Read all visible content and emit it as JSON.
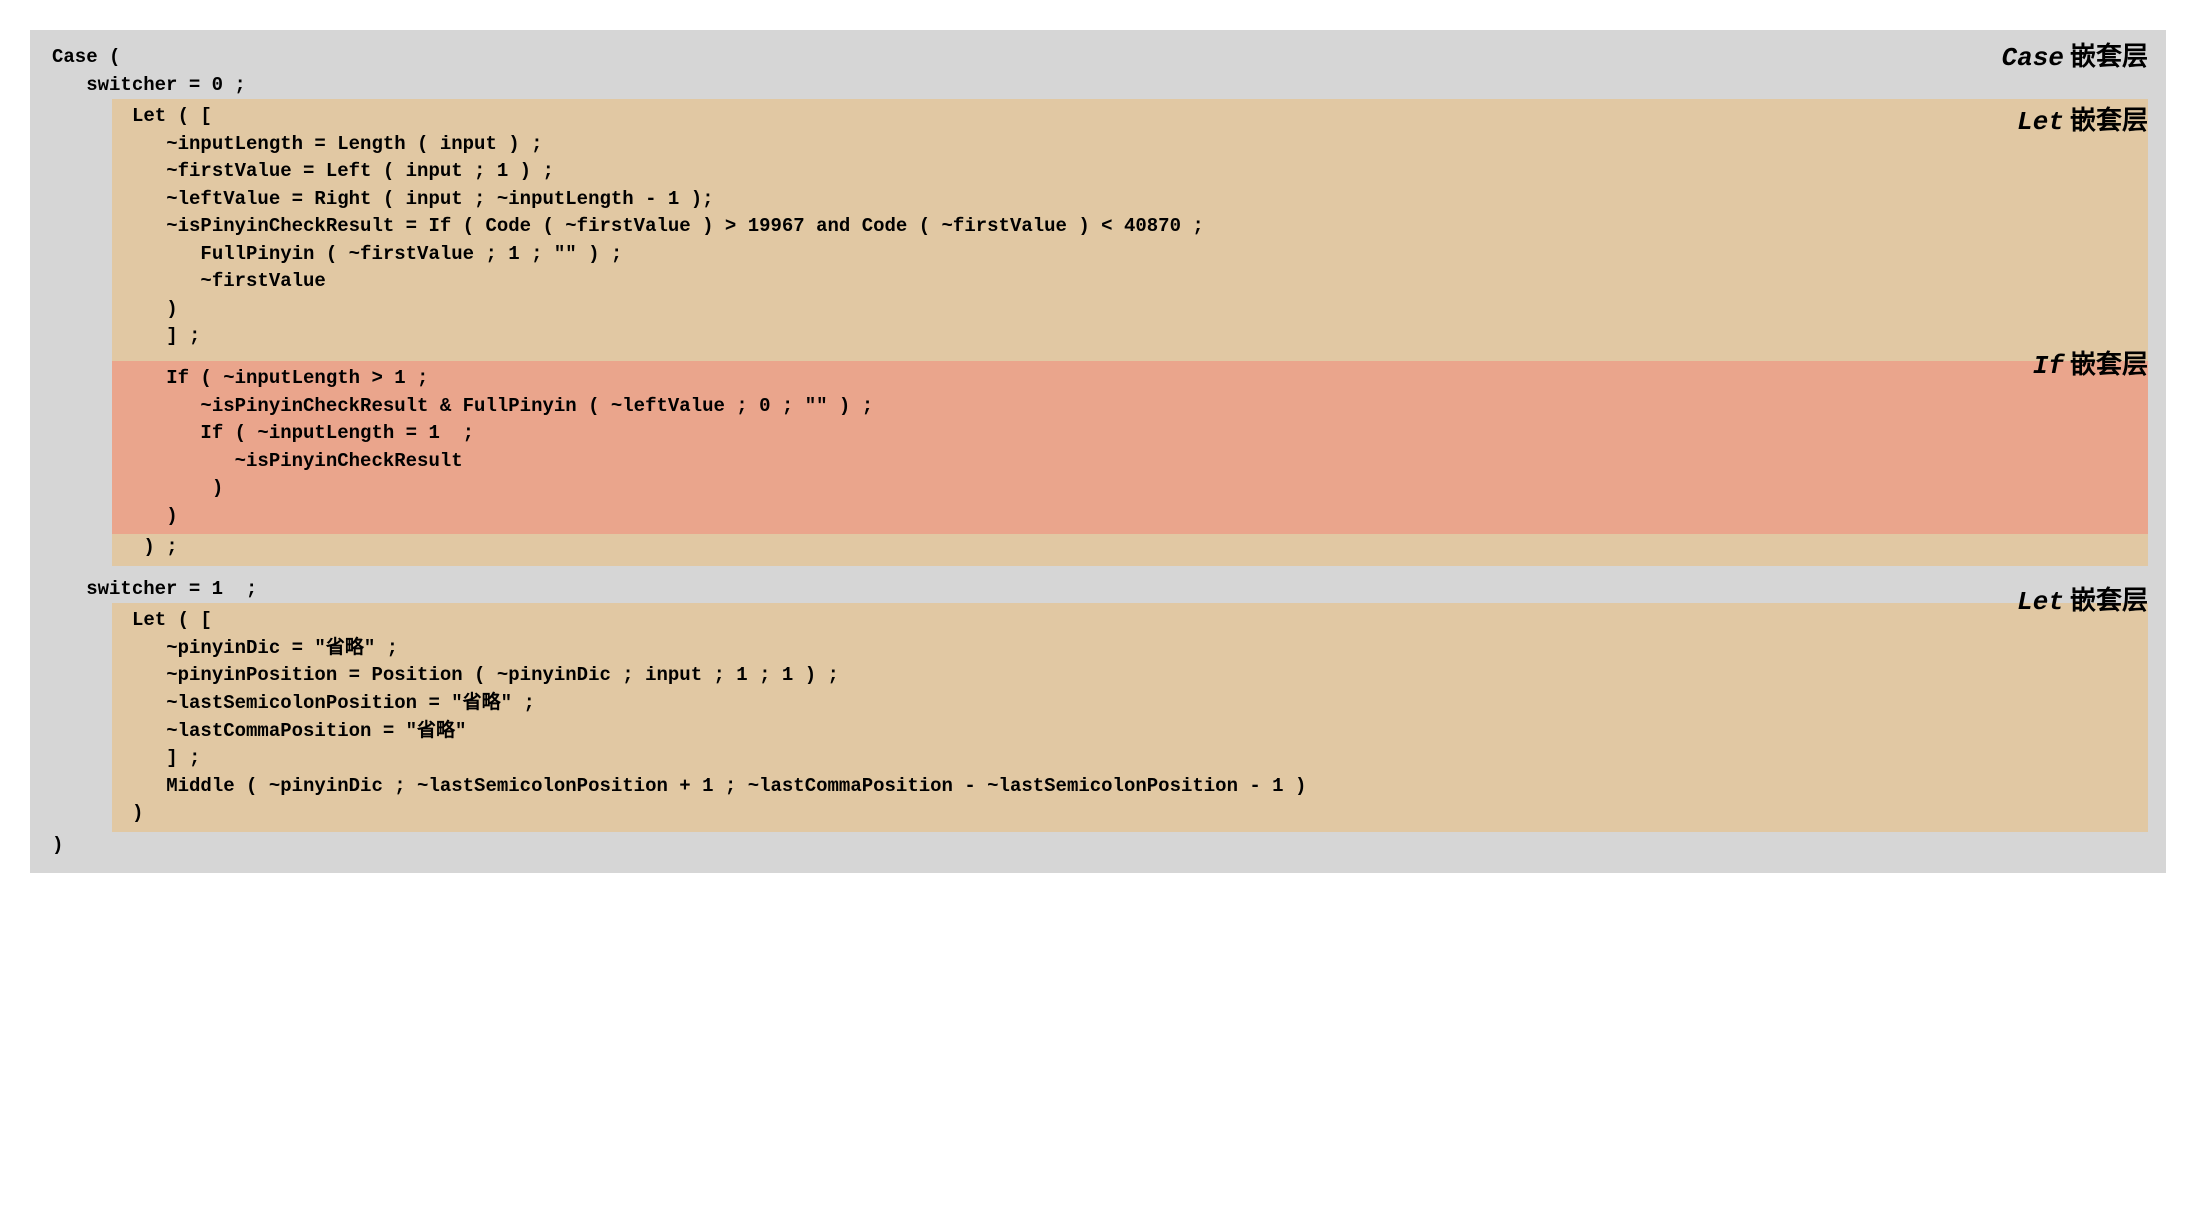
{
  "labels": {
    "case": {
      "kw": "Case",
      "cn": "嵌套层"
    },
    "let1": {
      "kw": "Let",
      "cn": "嵌套层"
    },
    "if": {
      "kw": "If",
      "cn": "嵌套层"
    },
    "let2": {
      "kw": "Let",
      "cn": "嵌套层"
    }
  },
  "code": {
    "case_open": "Case (",
    "switcher0": "   switcher = 0 ;",
    "let1_1": "Let ( [",
    "let1_2": "   ~inputLength = Length ( input ) ;",
    "let1_3": "   ~firstValue = Left ( input ; 1 ) ;",
    "let1_4": "   ~leftValue = Right ( input ; ~inputLength - 1 );",
    "let1_5": "   ~isPinyinCheckResult = If ( Code ( ~firstValue ) > 19967 and Code ( ~firstValue ) < 40870 ;",
    "let1_6": "      FullPinyin ( ~firstValue ; 1 ; \"\" ) ;",
    "let1_7": "      ~firstValue",
    "let1_8": "   )",
    "let1_9": "   ] ;",
    "if_1": "   If ( ~inputLength > 1 ;",
    "if_2": "      ~isPinyinCheckResult & FullPinyin ( ~leftValue ; 0 ; \"\" ) ;",
    "if_3": "      If ( ~inputLength = 1  ;",
    "if_4": "         ~isPinyinCheckResult",
    "if_5": "       )",
    "if_6": "   )",
    "let1_close": " ) ;",
    "switcher1": "   switcher = 1  ;",
    "let2_1": "Let ( [",
    "let2_2": "   ~pinyinDic = \"省略\" ;",
    "let2_3": "   ~pinyinPosition = Position ( ~pinyinDic ; input ; 1 ; 1 ) ;",
    "let2_4": "   ~lastSemicolonPosition = \"省略\" ;",
    "let2_5": "   ~lastCommaPosition = \"省略\"",
    "let2_6": "   ] ;",
    "let2_7": "   Middle ( ~pinyinDic ; ~lastSemicolonPosition + 1 ; ~lastCommaPosition - ~lastSemicolonPosition - 1 )",
    "let2_8": ")",
    "case_close": ")"
  }
}
